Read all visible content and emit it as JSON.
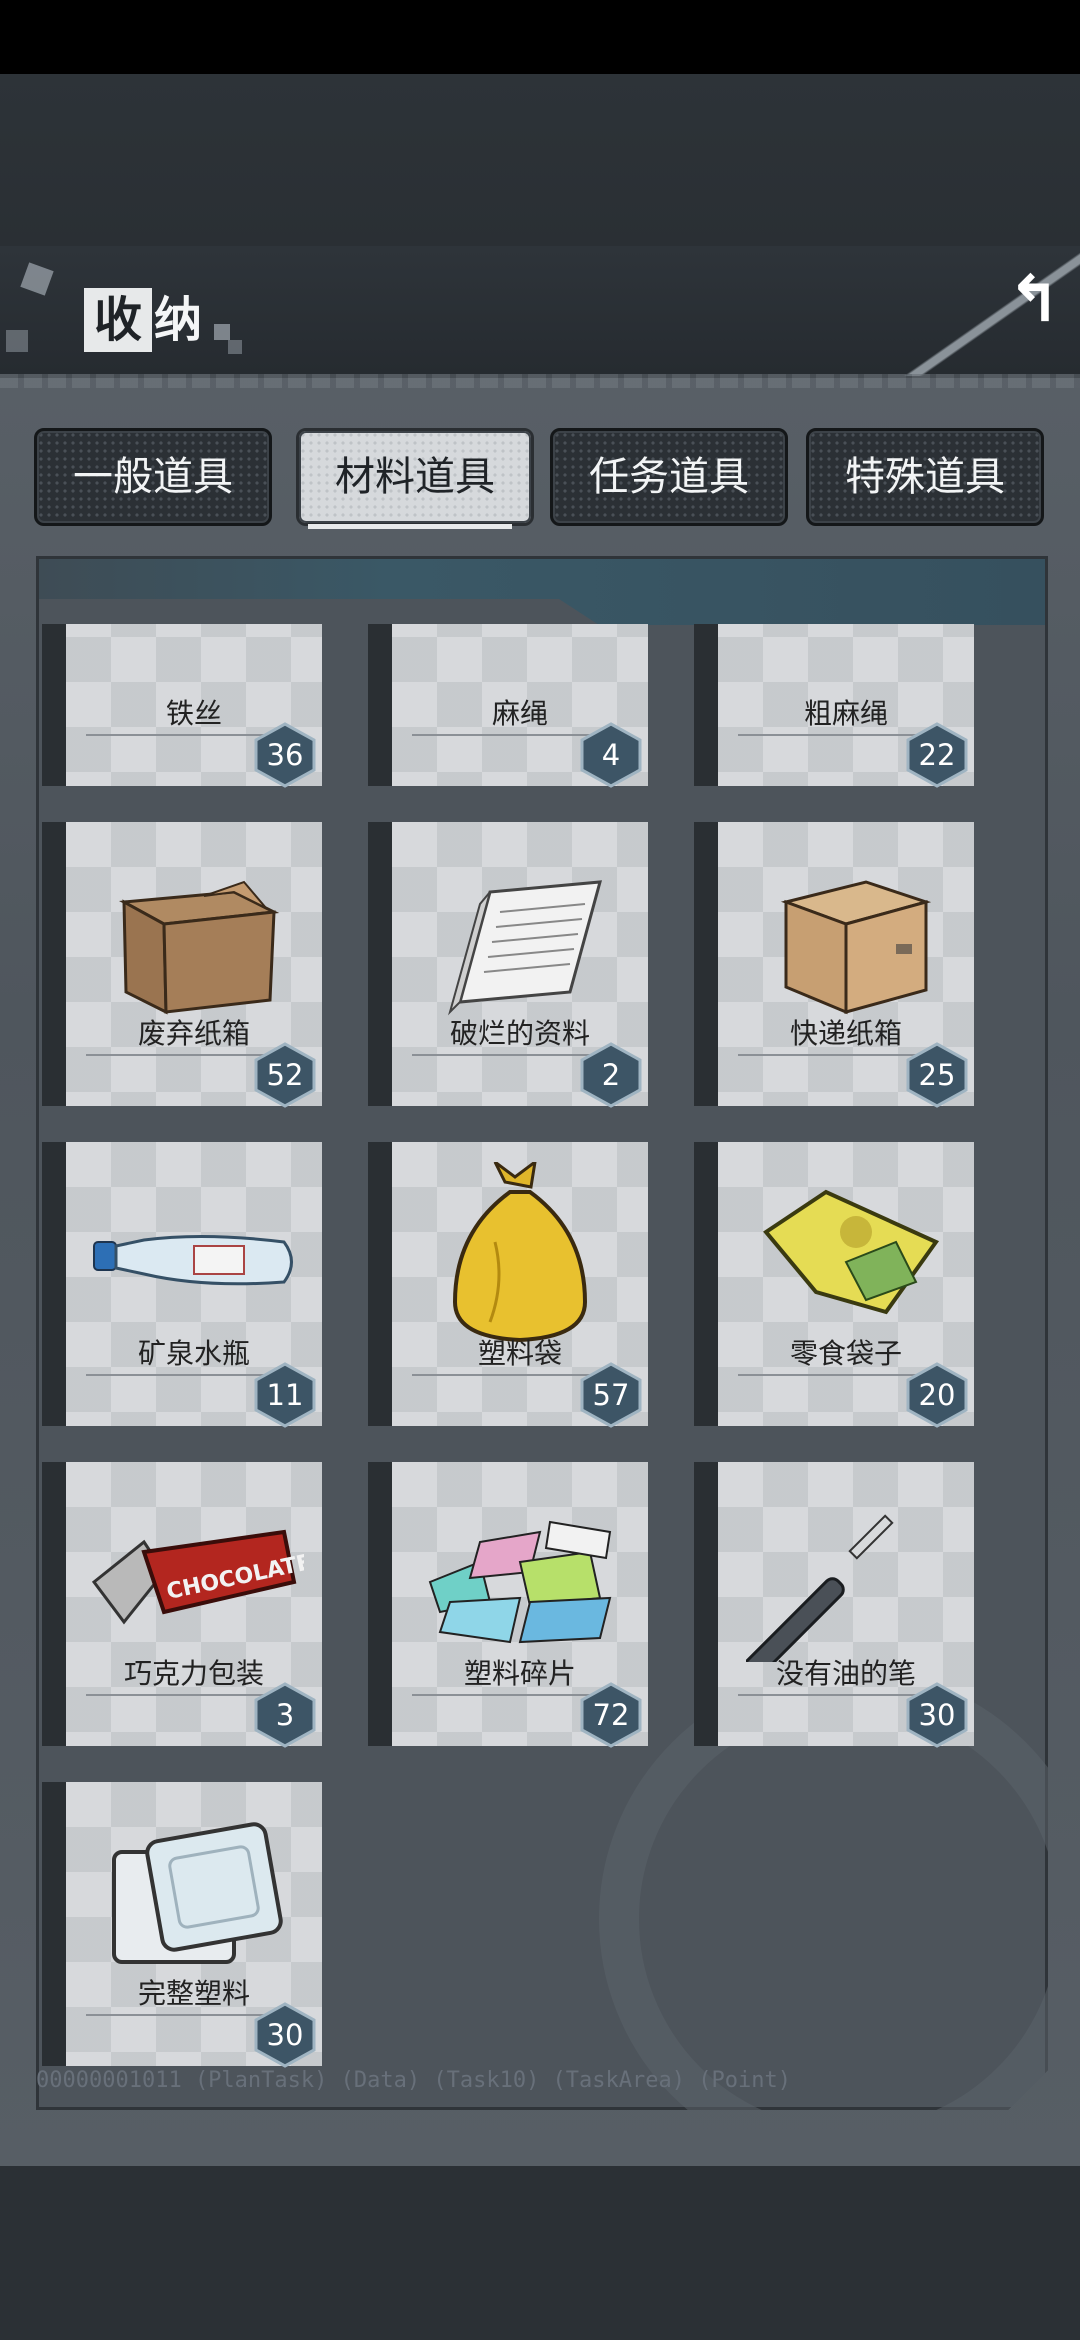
{
  "header": {
    "title_first": "收",
    "title_rest": "纳"
  },
  "tabs": [
    {
      "label": "一般道具",
      "active": false
    },
    {
      "label": "材料道具",
      "active": true
    },
    {
      "label": "任务道具",
      "active": false
    },
    {
      "label": "特殊道具",
      "active": false
    }
  ],
  "items": [
    {
      "name": "铁丝",
      "count": "36",
      "icon": "wire-coil-icon"
    },
    {
      "name": "麻绳",
      "count": "4",
      "icon": "rope-icon"
    },
    {
      "name": "粗麻绳",
      "count": "22",
      "icon": "thick-rope-icon"
    },
    {
      "name": "废弃纸箱",
      "count": "52",
      "icon": "worn-cardboard-box-icon"
    },
    {
      "name": "破烂的资料",
      "count": "2",
      "icon": "torn-documents-icon"
    },
    {
      "name": "快递纸箱",
      "count": "25",
      "icon": "delivery-box-icon"
    },
    {
      "name": "矿泉水瓶",
      "count": "11",
      "icon": "water-bottle-icon"
    },
    {
      "name": "塑料袋",
      "count": "57",
      "icon": "plastic-bag-icon"
    },
    {
      "name": "零食袋子",
      "count": "20",
      "icon": "snack-bag-icon"
    },
    {
      "name": "巧克力包装",
      "count": "3",
      "icon": "chocolate-wrapper-icon"
    },
    {
      "name": "塑料碎片",
      "count": "72",
      "icon": "plastic-shards-icon"
    },
    {
      "name": "没有油的笔",
      "count": "30",
      "icon": "empty-pen-icon"
    },
    {
      "name": "完整塑料",
      "count": "30",
      "icon": "plastic-container-icon"
    }
  ],
  "footer_debug": "00000001011     (PlanTask) (Data) (Task10) (TaskArea) (Point)",
  "colors": {
    "badge": "#3d5566",
    "badge_border": "#9fb4c2",
    "card": "#d7d9dc"
  }
}
